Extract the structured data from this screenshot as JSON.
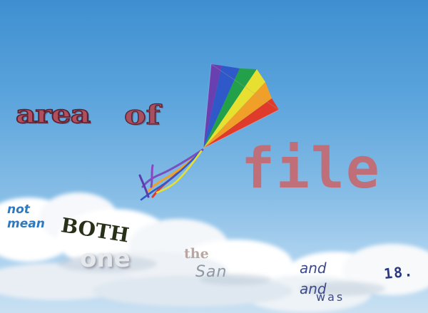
{
  "scene": {
    "description_colors": {
      "sky_top": "#3f8fd0",
      "sky_bottom": "#c9e0f2",
      "cloud": "#ffffff"
    },
    "kite": {
      "stripes": [
        "#6a3fb0",
        "#2f58c8",
        "#22a04a",
        "#e8e030",
        "#f0a028",
        "#e03a2a"
      ]
    }
  },
  "words": {
    "area": "area",
    "of": "of",
    "file": "file",
    "not": "not",
    "mean": "mean",
    "both": "BOTH",
    "one": "one",
    "the": "the",
    "san": "San",
    "and1": "and",
    "and2": "and",
    "was": "was",
    "eighteen": "18."
  }
}
